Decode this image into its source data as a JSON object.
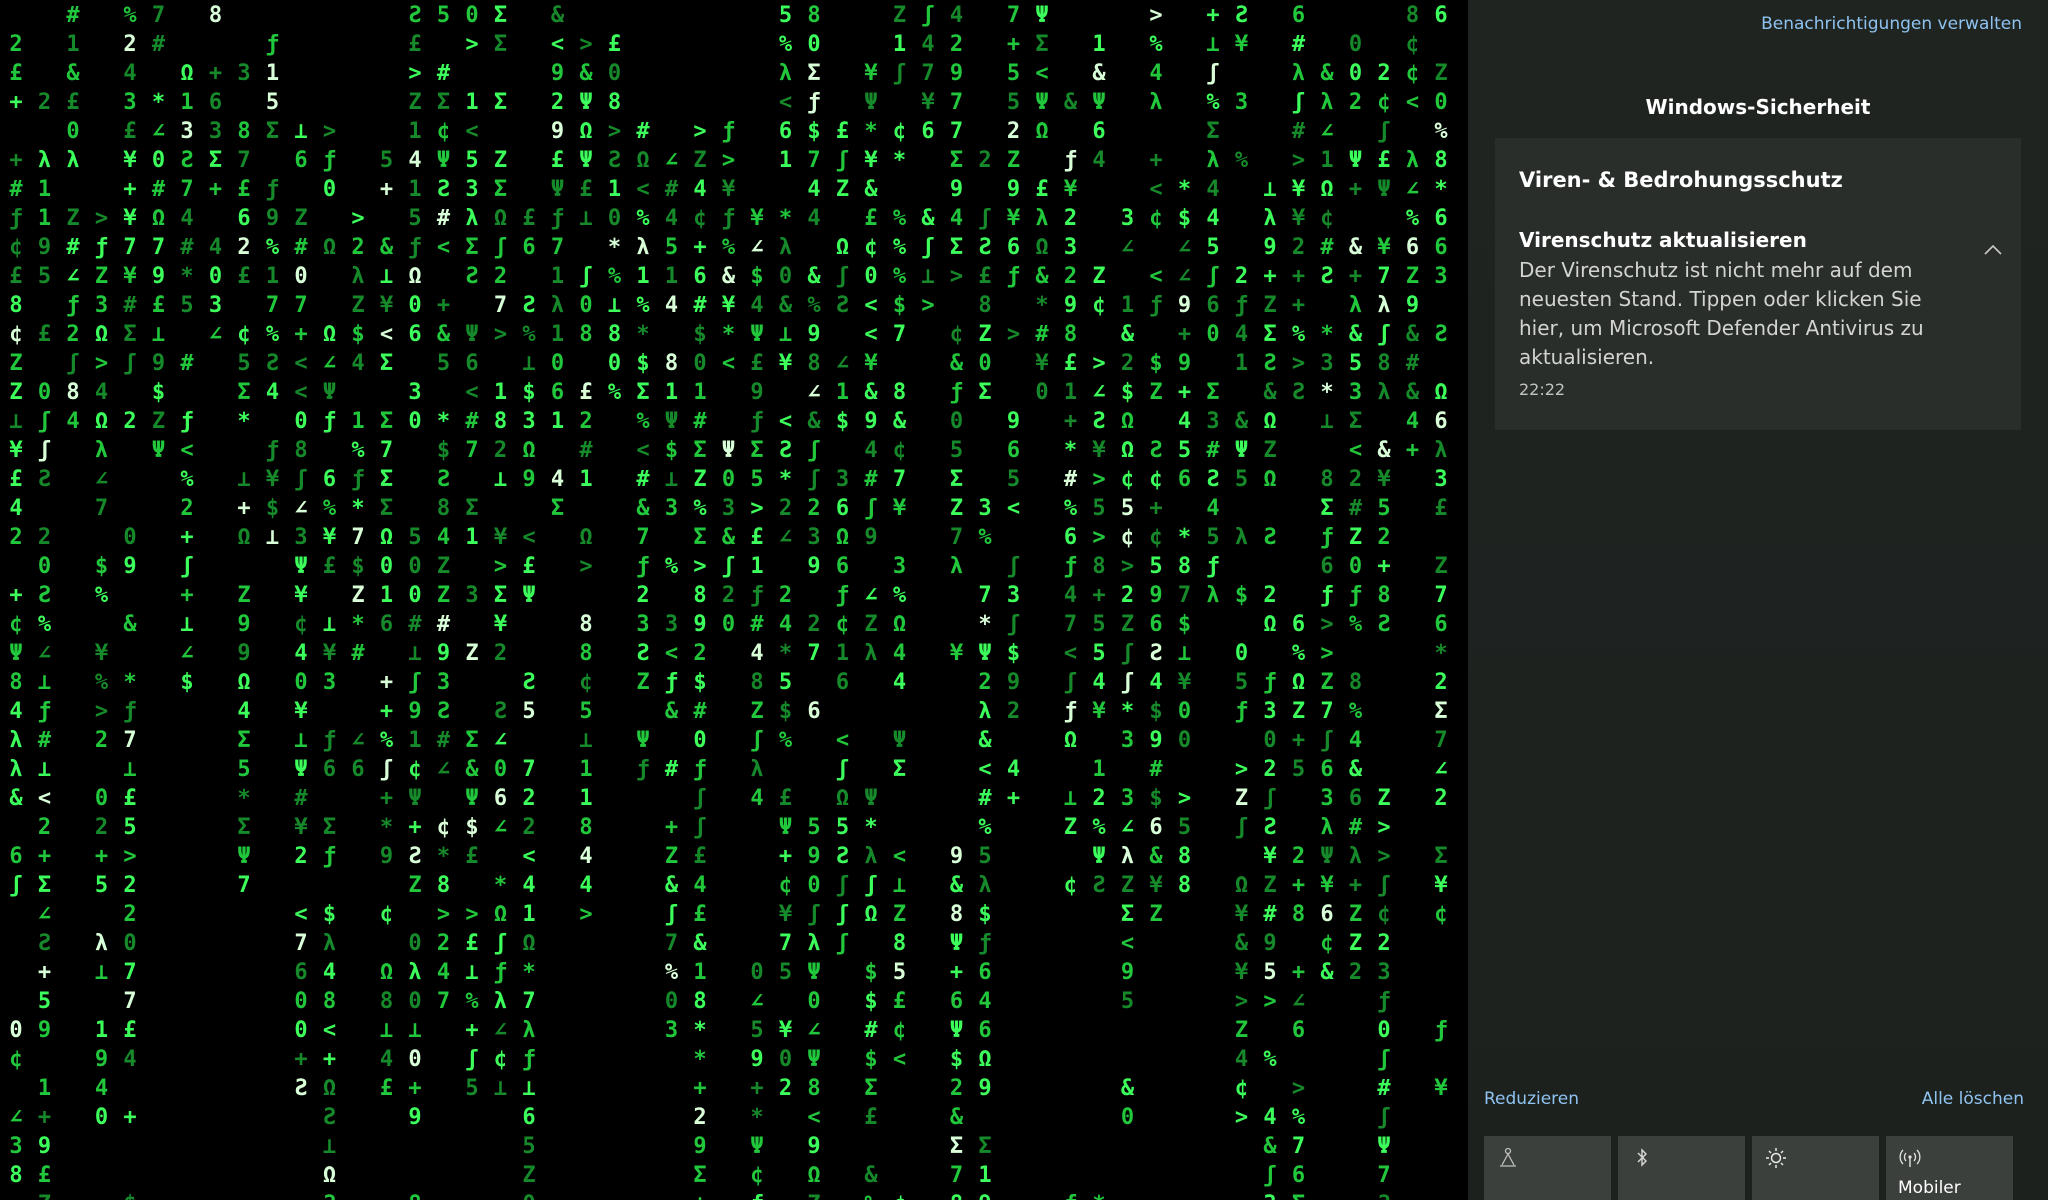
{
  "action_center": {
    "manage_notifications": "Benachrichtigungen verwalten",
    "app_title": "Windows-Sicherheit",
    "notification": {
      "group": "Viren- & Bedrohungsschutz",
      "title": "Virenschutz aktualisieren",
      "body": "Der Virenschutz ist nicht mehr auf dem neuesten Stand. Tippen oder klicken Sie hier, um Microsoft Defender Antivirus zu aktualisieren.",
      "time": "22:22"
    },
    "reduce": "Reduzieren",
    "clear_all": "Alle löschen",
    "tiles": [
      {
        "icon": "tablet-mode-icon",
        "label": ""
      },
      {
        "icon": "bluetooth-icon",
        "label": ""
      },
      {
        "icon": "brightness-icon",
        "label": ""
      },
      {
        "icon": "mobile-hotspot-icon",
        "label": "Mobiler"
      }
    ]
  },
  "colors": {
    "panel_bg": "#1f2320",
    "card_bg": "#2a2e2b",
    "link": "#8ec3f0",
    "matrix_green": "#3cff5a"
  }
}
